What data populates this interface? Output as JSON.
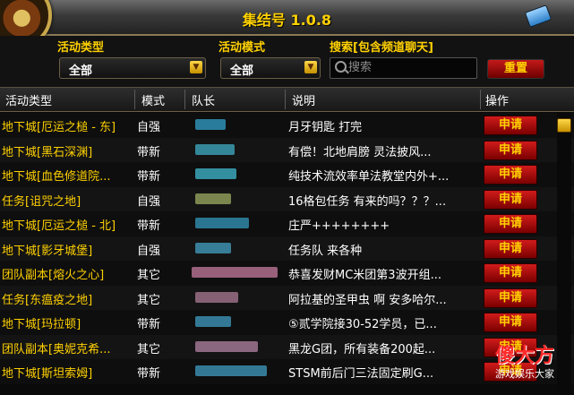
{
  "window": {
    "title": "集结号 1.0.8"
  },
  "filters": {
    "activity_type_label": "活动类型",
    "activity_type_value": "全部",
    "activity_mode_label": "活动模式",
    "activity_mode_value": "全部",
    "search_label": "搜索[包含频道聊天]",
    "search_placeholder": "搜索",
    "reset_label": "重置"
  },
  "table": {
    "headers": {
      "type": "活动类型",
      "mode": "模式",
      "leader": "队长",
      "desc": "说明",
      "action": "操作"
    },
    "rows": [
      {
        "type": "地下城[厄运之槌 - 东]",
        "mode": "自强",
        "desc": "月牙钥匙 打完",
        "action": "申请"
      },
      {
        "type": "地下城[黑石深渊]",
        "mode": "带新",
        "desc": "有偿！北地肩膀 灵法披风...",
        "action": "申请"
      },
      {
        "type": "地下城[血色修道院...",
        "mode": "带新",
        "desc": "纯技术流效率单法教堂内外+...",
        "action": "申请"
      },
      {
        "type": "任务[诅咒之地]",
        "mode": "自强",
        "desc": "16格包任务 有来的吗？？？...",
        "action": "申请"
      },
      {
        "type": "地下城[厄运之槌 - 北]",
        "mode": "带新",
        "desc": "庄严++++++++",
        "action": "申请"
      },
      {
        "type": "地下城[影牙城堡]",
        "mode": "自强",
        "desc": "任务队 来各种",
        "action": "申请"
      },
      {
        "type": "团队副本[熔火之心]",
        "mode": "其它",
        "desc": "恭喜发财MC米团第3波开组...",
        "action": "申请"
      },
      {
        "type": "任务[东瘟疫之地]",
        "mode": "其它",
        "desc": "阿拉基的圣甲虫 啊 安多哈尔...",
        "action": "申请"
      },
      {
        "type": "地下城[玛拉顿]",
        "mode": "带新",
        "desc": "⑤贰学院接30-52学员，已...",
        "action": "申请"
      },
      {
        "type": "团队副本[奥妮克希...",
        "mode": "其它",
        "desc": "黑龙G团，所有装备200起...",
        "action": "申请"
      },
      {
        "type": "地下城[斯坦索姆]",
        "mode": "带新",
        "desc": "STSM前后门三法固定刷G...",
        "action": "申请"
      }
    ]
  },
  "watermark": {
    "main": "傻大方",
    "sub": "游戏娱乐大家"
  },
  "colors": {
    "accent_gold": "#ffd100",
    "button_red": "#c41a1a"
  },
  "icons": {
    "close": "close-icon",
    "search": "search-icon",
    "dropdown": "chevron-down-icon",
    "scroll_up": "scroll-up-icon"
  }
}
